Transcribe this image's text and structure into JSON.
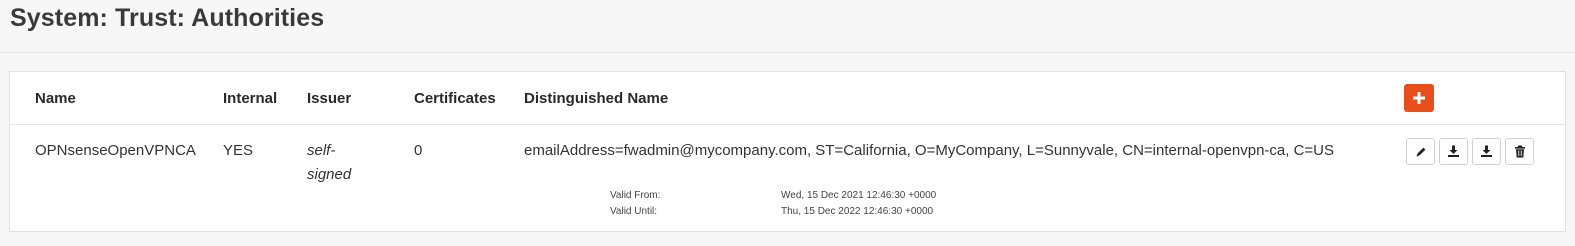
{
  "page": {
    "title": "System: Trust: Authorities"
  },
  "table": {
    "columns": [
      "Name",
      "Internal",
      "Issuer",
      "Certificates",
      "Distinguished Name"
    ],
    "rows": [
      {
        "name": "OPNsenseOpenVPNCA",
        "internal": "YES",
        "issuer": "self-signed",
        "certificates": "0",
        "distinguished_name": "emailAddress=fwadmin@mycompany.com, ST=California, O=MyCompany, L=Sunnyvale, CN=internal-openvpn-ca, C=US",
        "valid_from_label": "Valid From:",
        "valid_from": "Wed, 15 Dec 2021 12:46:30 +0000",
        "valid_until_label": "Valid Until:",
        "valid_until": "Thu, 15 Dec 2022 12:46:30 +0000"
      }
    ]
  },
  "actions": {
    "add_icon": "plus-icon",
    "row_icons": [
      "pencil-icon",
      "download-icon",
      "download-icon",
      "trash-icon"
    ]
  },
  "colors": {
    "accent": "#e84e1b",
    "background": "#f7f7f7"
  }
}
